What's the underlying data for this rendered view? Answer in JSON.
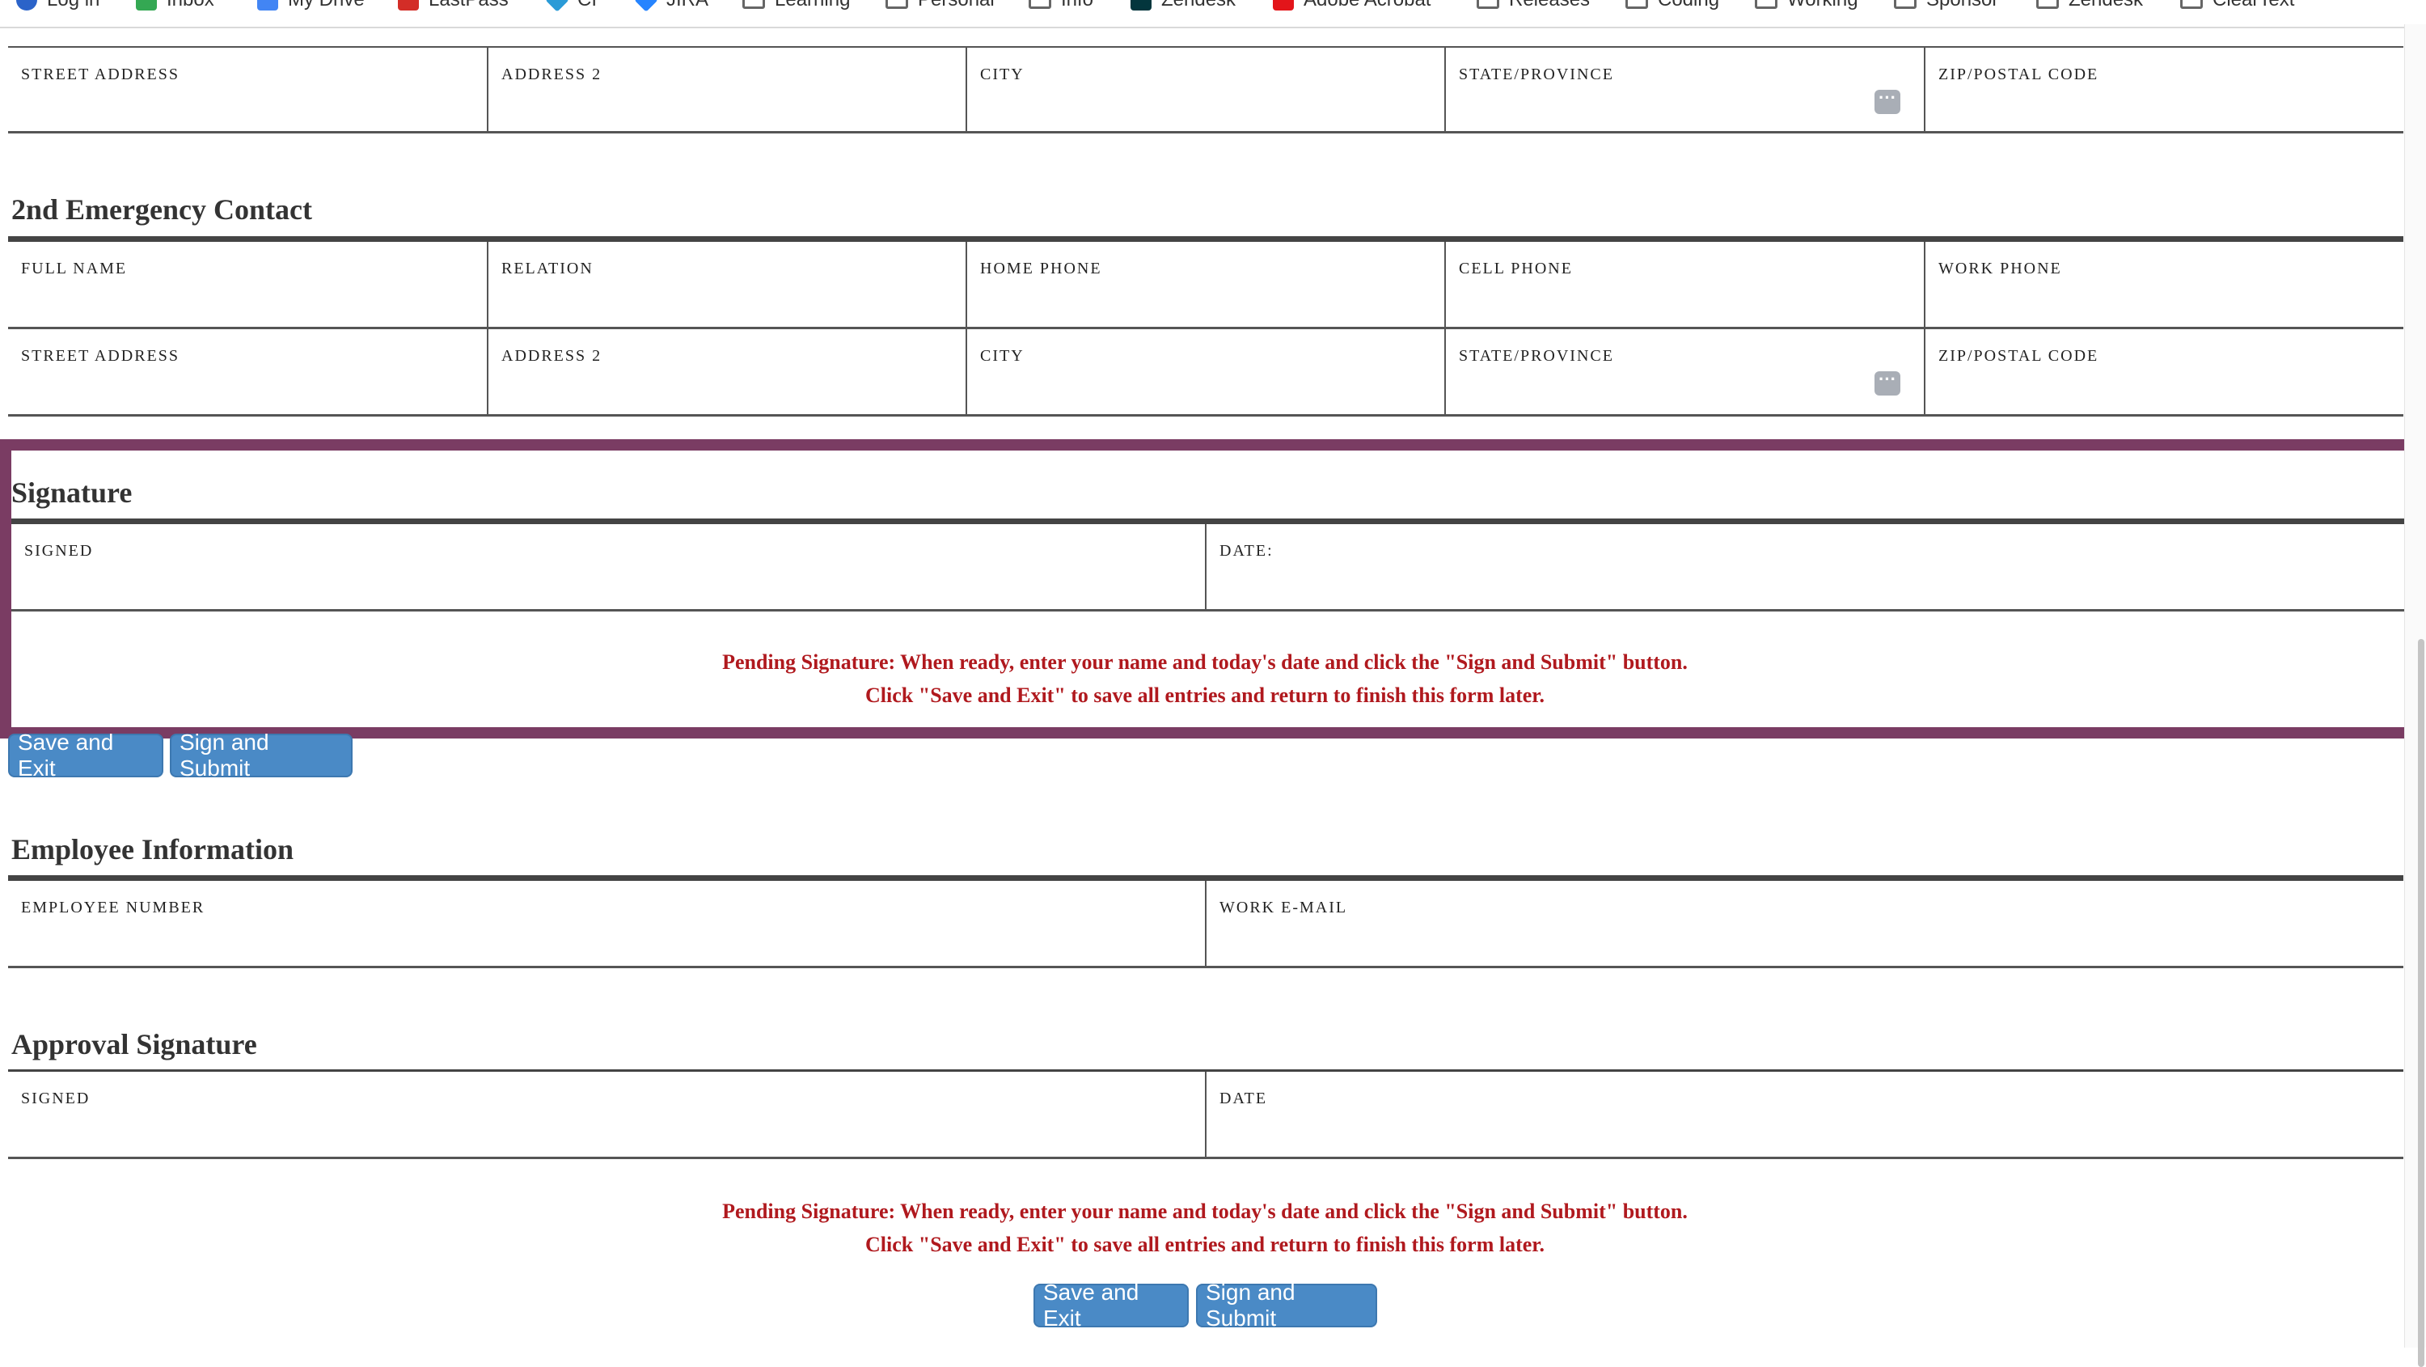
{
  "bookmarks": [
    {
      "label": "Log in",
      "icon": "globe-icon",
      "color": "#2b63c9"
    },
    {
      "label": "Inbox",
      "icon": "calendar-grid-icon",
      "color": "#34a853"
    },
    {
      "label": "My Drive",
      "icon": "drive-icon",
      "color": "#4285f4"
    },
    {
      "label": "LastPass",
      "icon": "lastpass-icon",
      "color": "#d32d27"
    },
    {
      "label": "CI",
      "icon": "shape-icon",
      "color": "#2a9bd7"
    },
    {
      "label": "JIRA",
      "icon": "jira-icon",
      "color": "#2684ff"
    },
    {
      "label": "Learning",
      "icon": "folder-icon"
    },
    {
      "label": "Personal",
      "icon": "folder-icon"
    },
    {
      "label": "Info",
      "icon": "folder-icon"
    },
    {
      "label": "Zendesk",
      "icon": "zendesk-icon",
      "color": "#03363d"
    },
    {
      "label": "Adobe Acrobat",
      "icon": "acrobat-icon",
      "color": "#e3151a"
    },
    {
      "label": "Releases",
      "icon": "folder-icon"
    },
    {
      "label": "Coding",
      "icon": "folder-icon"
    },
    {
      "label": "Working",
      "icon": "folder-icon"
    },
    {
      "label": "Sponsor",
      "icon": "folder-icon"
    },
    {
      "label": "Zendesk",
      "icon": "folder-icon"
    },
    {
      "label": "ClearText",
      "icon": "folder-icon"
    }
  ],
  "first_contact_address": {
    "street": "STREET ADDRESS",
    "address2": "ADDRESS 2",
    "city": "CITY",
    "state": "STATE/PROVINCE",
    "zip": "ZIP/POSTAL CODE"
  },
  "second_contact": {
    "title": "2nd Emergency Contact",
    "full_name": "FULL NAME",
    "relation": "RELATION",
    "home_phone": "HOME PHONE",
    "cell_phone": "CELL PHONE",
    "work_phone": "WORK PHONE",
    "street": "STREET ADDRESS",
    "address2": "ADDRESS 2",
    "city": "CITY",
    "state": "STATE/PROVINCE",
    "zip": "ZIP/POSTAL CODE"
  },
  "signature": {
    "title": "Signature",
    "signed": "SIGNED",
    "date": "DATE:",
    "pending_line1": "Pending Signature: When ready, enter your name and today's date and click the \"Sign and Submit\" button.",
    "pending_line2": "Click \"Save and Exit\" to save all entries and return to finish this form later.",
    "save_exit": "Save and Exit",
    "sign_submit": "Sign and Submit"
  },
  "employee_info": {
    "title": "Employee Information",
    "employee_number": "EMPLOYEE NUMBER",
    "work_email": "WORK E-MAIL"
  },
  "approval": {
    "title": "Approval Signature",
    "signed": "SIGNED",
    "date": "DATE",
    "pending_line1": "Pending Signature: When ready, enter your name and today's date and click the \"Sign and Submit\" button.",
    "pending_line2": "Click \"Save and Exit\" to save all entries and return to finish this form later.",
    "save_exit": "Save and Exit",
    "sign_submit": "Sign and Submit"
  },
  "colors": {
    "accent_frame": "#7a3c63",
    "button": "#4a8ac6",
    "pending_text": "#b0191e"
  }
}
